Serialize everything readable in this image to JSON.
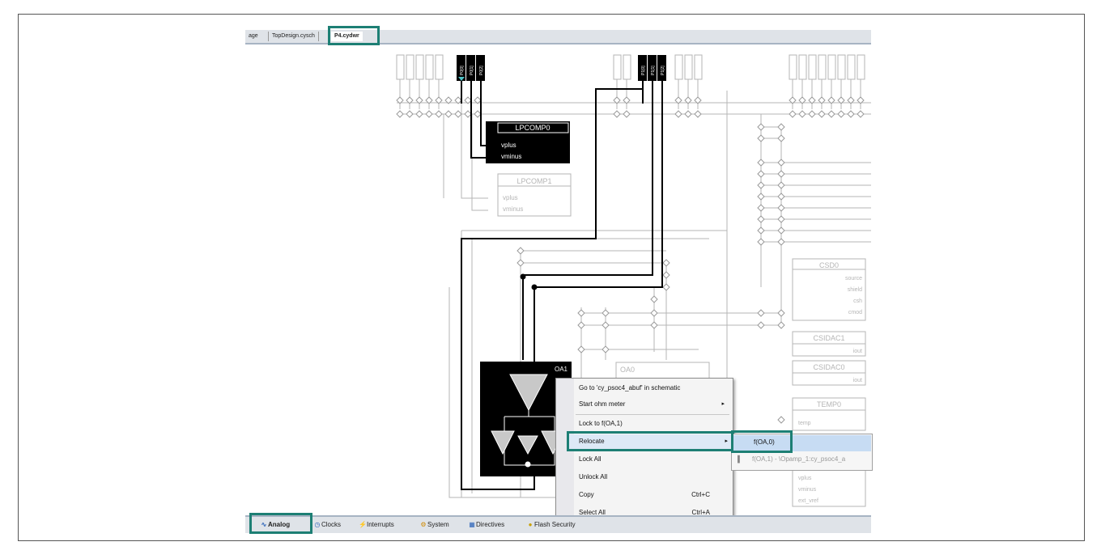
{
  "top_tabs": [
    {
      "label": "age"
    },
    {
      "label": "TopDesign.cysch"
    },
    {
      "label": "P4.cydwr"
    }
  ],
  "pins_left": [
    "P0[0]",
    "P0[1]",
    "P0[2]"
  ],
  "pins_mid": [
    "P1[0]",
    "P1[1]",
    "P1[2]"
  ],
  "blocks": {
    "lpcomp0": {
      "title": "LPCOMP0",
      "ports": [
        "vplus",
        "vminus"
      ]
    },
    "lpcomp1": {
      "title": "LPCOMP1",
      "ports": [
        "vplus",
        "vminus"
      ]
    },
    "csd0": {
      "title": "CSD0",
      "ports": [
        "source",
        "shield",
        "csh",
        "cmod"
      ]
    },
    "csidac1": {
      "title": "CSIDAC1",
      "ports": [
        "iout"
      ]
    },
    "csidac0": {
      "title": "CSIDAC0",
      "ports": [
        "iout"
      ]
    },
    "temp0": {
      "title": "TEMP0",
      "ports": [
        "temp"
      ]
    },
    "oa1": {
      "title": "OA1"
    },
    "oa0": {
      "title": "OA0",
      "ports": [
        "vplus",
        "vminus",
        "ext_vref"
      ]
    }
  },
  "context_menu": {
    "items": [
      {
        "label": "Go to 'cy_psoc4_abuf' in schematic"
      },
      {
        "label": "Start ohm meter",
        "arrow": "▸"
      },
      {
        "label": "Lock to f(OA,1)"
      },
      {
        "label": "Relocate",
        "arrow": "▸"
      },
      {
        "label": "Lock All"
      },
      {
        "label": "Unlock All"
      },
      {
        "label": "Copy",
        "shortcut": "Ctrl+C"
      },
      {
        "label": "Select All",
        "shortcut": "Ctrl+A"
      }
    ],
    "submenu": [
      {
        "label": "f(OA,0)"
      },
      {
        "label": "f(OA,1) - \\Opamp_1:cy_psoc4_a"
      }
    ]
  },
  "bottom_tabs": [
    {
      "label": "Analog",
      "icon": "analog-wave-icon"
    },
    {
      "label": "Clocks",
      "icon": "clock-icon"
    },
    {
      "label": "Interrupts",
      "icon": "interrupt-icon"
    },
    {
      "label": "System",
      "icon": "system-icon"
    },
    {
      "label": "Directives",
      "icon": "directives-icon"
    },
    {
      "label": "Flash Security",
      "icon": "flash-security-icon"
    }
  ],
  "colors": {
    "highlight": "#1d7f74",
    "tab_bg": "#dfe3e8",
    "selection": "#c7dcf3"
  }
}
